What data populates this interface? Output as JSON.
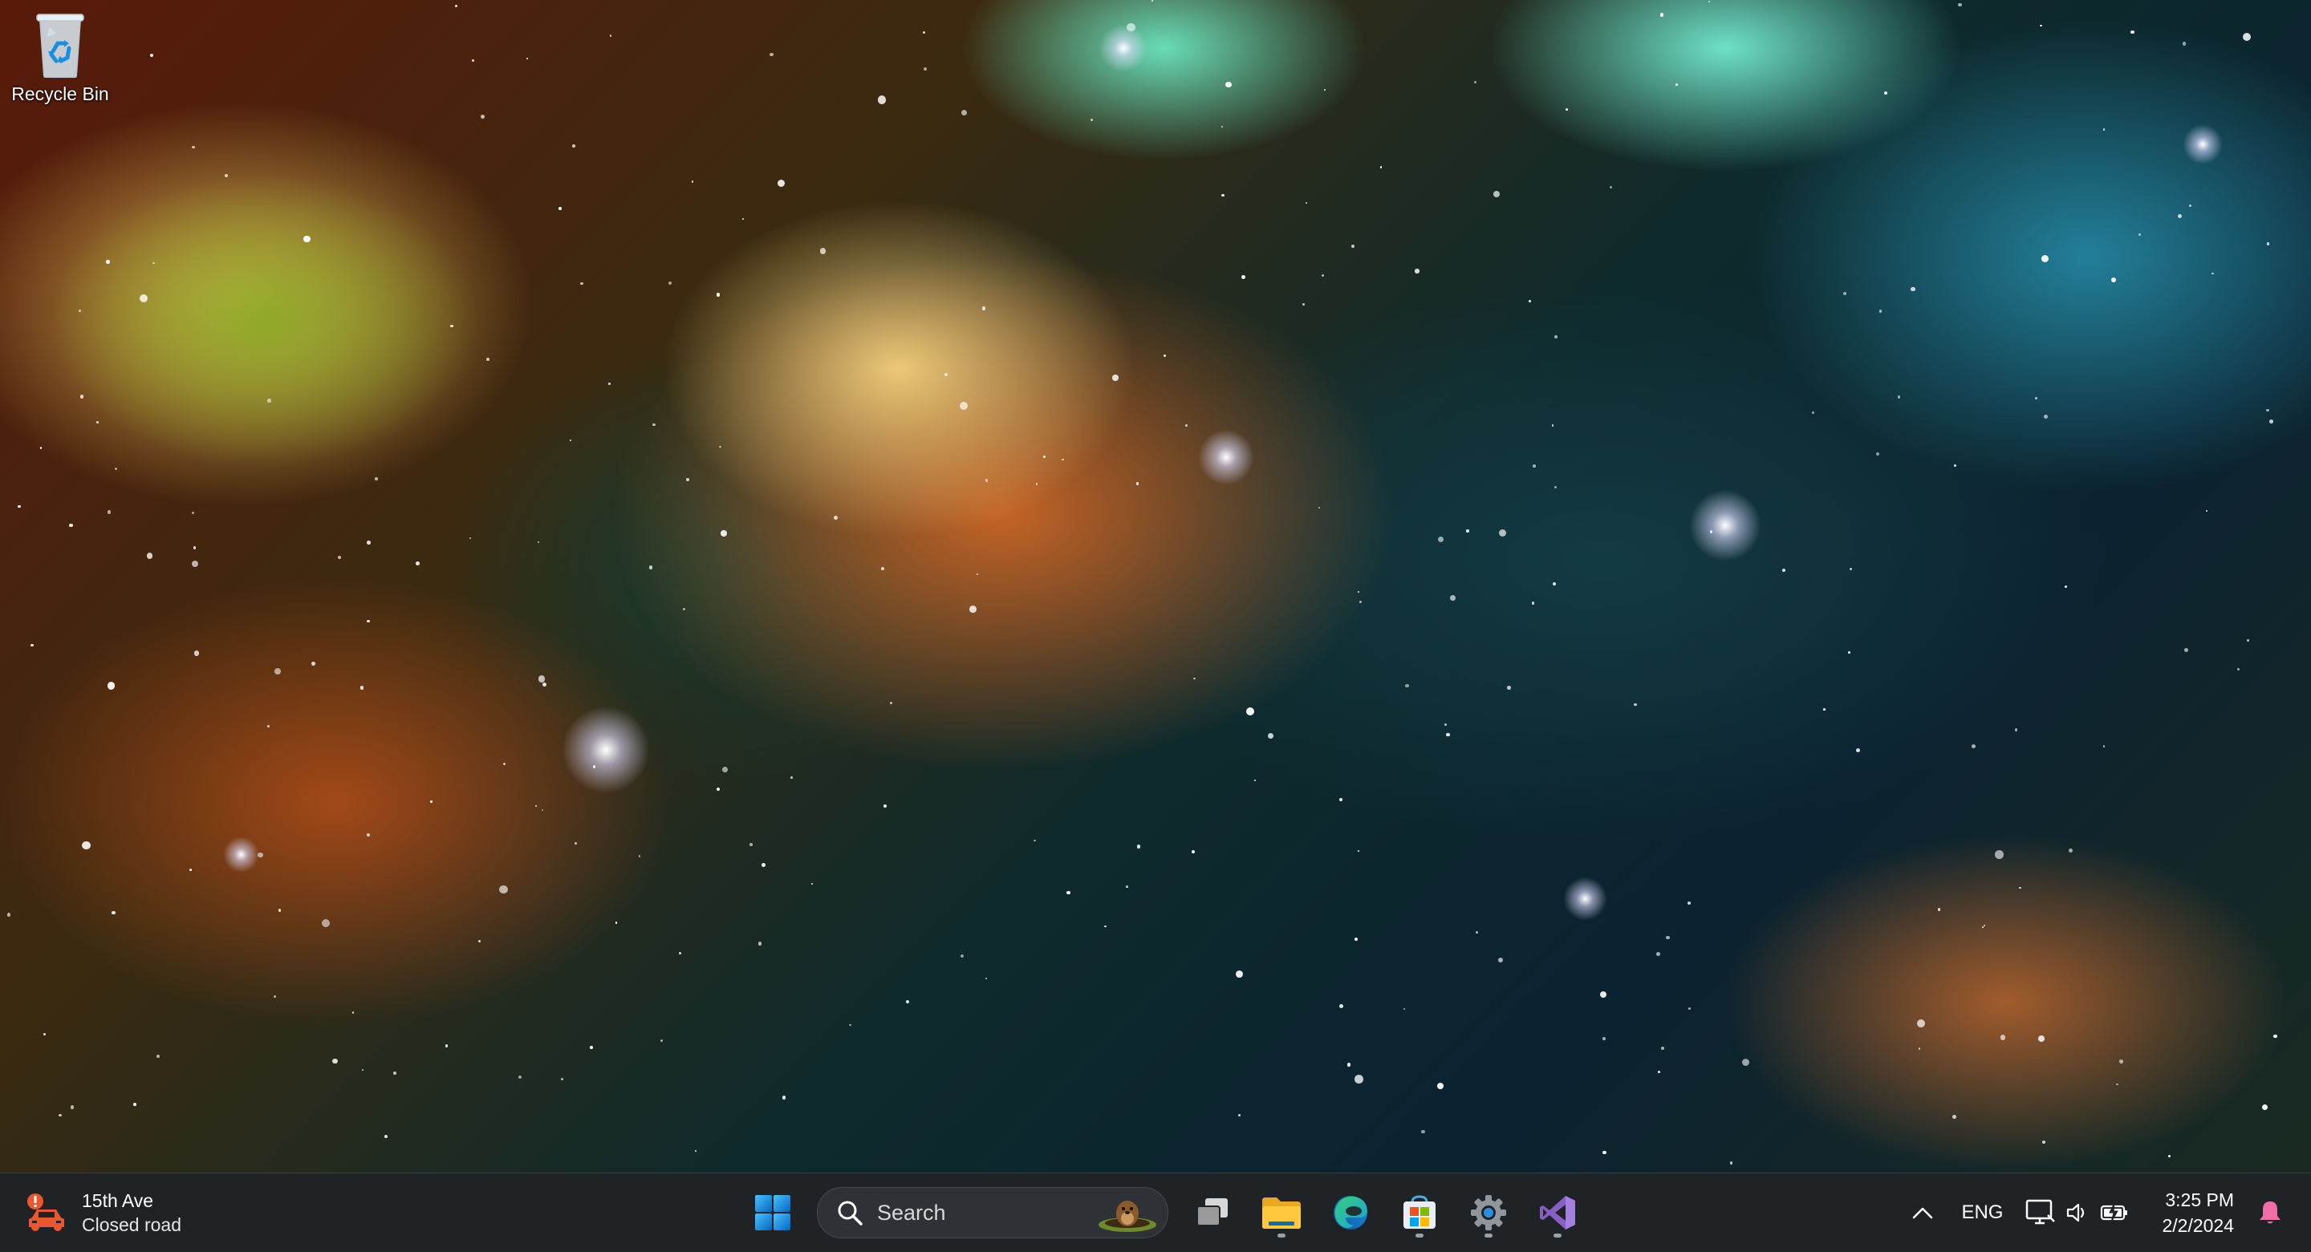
{
  "desktop": {
    "icons": [
      {
        "label": "Recycle Bin",
        "icon": "recycle-bin-icon"
      }
    ]
  },
  "taskbar": {
    "widget": {
      "icon": "traffic-alert-icon",
      "title": "15th Ave",
      "subtitle": "Closed road"
    },
    "search": {
      "placeholder": "Search",
      "icon": "search-icon"
    },
    "apps": [
      {
        "name": "Start",
        "icon": "windows-start-icon",
        "running": false
      },
      {
        "name": "Task View",
        "icon": "task-view-icon",
        "running": false
      },
      {
        "name": "File Explorer",
        "icon": "file-explorer-icon",
        "running": true
      },
      {
        "name": "Microsoft Edge",
        "icon": "edge-icon",
        "running": false
      },
      {
        "name": "Microsoft Store",
        "icon": "store-icon",
        "running": true
      },
      {
        "name": "Settings",
        "icon": "settings-gear-icon",
        "running": true
      },
      {
        "name": "Visual Studio",
        "icon": "visual-studio-icon",
        "running": true
      }
    ],
    "tray": {
      "language": "ENG",
      "time": "3:25 PM",
      "date": "2/2/2024"
    }
  },
  "colors": {
    "taskbar_bg": "#1f2326",
    "accent_blue": "#0078d4",
    "vs_purple": "#865fc5"
  }
}
